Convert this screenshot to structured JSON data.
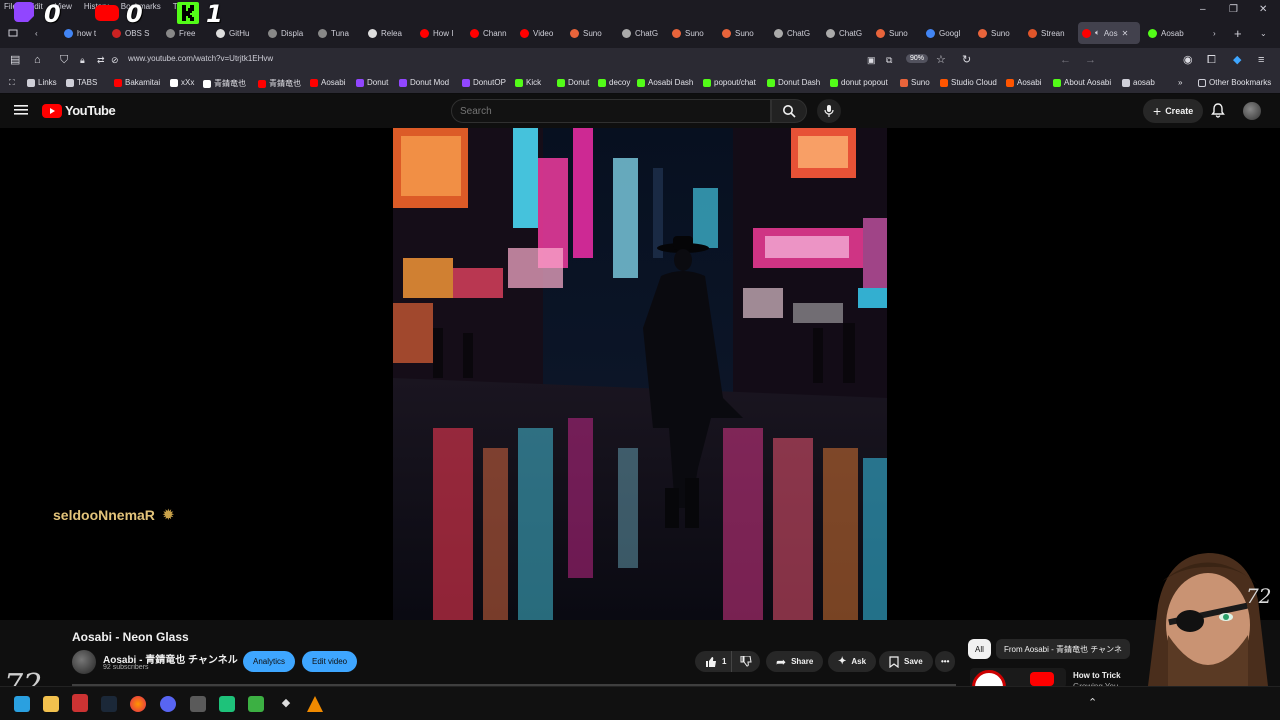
{
  "browser": {
    "menu": [
      "File",
      "Edit",
      "View",
      "History",
      "Bookmarks",
      "Tools"
    ],
    "overlay_counts": [
      "0",
      "0",
      "1"
    ],
    "tabs": [
      {
        "label": "how t",
        "color": "#4285f4"
      },
      {
        "label": "OBS S",
        "color": "#cc2222"
      },
      {
        "label": "Free",
        "color": "#888888"
      },
      {
        "label": "GitHu",
        "color": "#dddddd"
      },
      {
        "label": "Displa",
        "color": "#888888"
      },
      {
        "label": "Tuna",
        "color": "#888888"
      },
      {
        "label": "Relea",
        "color": "#dddddd"
      },
      {
        "label": "How I",
        "color": "#ff0000"
      },
      {
        "label": "Chann",
        "color": "#ff0000"
      },
      {
        "label": "Video",
        "color": "#ff0000"
      },
      {
        "label": "Suno",
        "color": "#e8643b"
      },
      {
        "label": "ChatG",
        "color": "#aaaaaa"
      },
      {
        "label": "Suno",
        "color": "#e8643b"
      },
      {
        "label": "Suno",
        "color": "#e8643b"
      },
      {
        "label": "ChatG",
        "color": "#aaaaaa"
      },
      {
        "label": "ChatG",
        "color": "#aaaaaa"
      },
      {
        "label": "Suno",
        "color": "#e8643b"
      },
      {
        "label": "Googl",
        "color": "#4285f4"
      },
      {
        "label": "Suno",
        "color": "#e8643b"
      },
      {
        "label": "Strean",
        "color": "#e0552a"
      },
      {
        "label": "Aos",
        "color": "#ff0000"
      },
      {
        "label": "Aosab",
        "color": "#53fc18"
      }
    ],
    "url": "www.youtube.com/watch?v=Utrjtk1EHvw",
    "zoom": "90%",
    "bookmarks": [
      {
        "label": "Links",
        "color": "#cfcfd8"
      },
      {
        "label": "TABS",
        "color": "#cfcfd8"
      },
      {
        "label": "Bakamitai",
        "color": "#ff0000"
      },
      {
        "label": "xXx",
        "color": "#ffffff"
      },
      {
        "label": "青錆竜也",
        "color": "#ffffff"
      },
      {
        "label": "青錆竜也",
        "color": "#ff0000"
      },
      {
        "label": "Aosabi",
        "color": "#ff0000"
      },
      {
        "label": "Donut",
        "color": "#9146ff"
      },
      {
        "label": "Donut Mod",
        "color": "#9146ff"
      },
      {
        "label": "DonutOP",
        "color": "#9146ff"
      },
      {
        "label": "Kick",
        "color": "#53fc18"
      },
      {
        "label": "Donut",
        "color": "#53fc18"
      },
      {
        "label": "decoy",
        "color": "#53fc18"
      },
      {
        "label": "Aosabi Dash",
        "color": "#53fc18"
      },
      {
        "label": "popout/chat",
        "color": "#53fc18"
      },
      {
        "label": "Donut Dash",
        "color": "#53fc18"
      },
      {
        "label": "donut popout",
        "color": "#53fc18"
      },
      {
        "label": "Suno",
        "color": "#e8643b"
      },
      {
        "label": "Studio Cloud",
        "color": "#ff5500"
      },
      {
        "label": "Aosabi",
        "color": "#ff5500"
      },
      {
        "label": "About Aosabi",
        "color": "#53fc18"
      },
      {
        "label": "aosab",
        "color": "#cfcfd8"
      }
    ],
    "other_bookmarks": "Other Bookmarks"
  },
  "youtube": {
    "logo_text": "YouTube",
    "search_placeholder": "Search",
    "create_label": "Create"
  },
  "video": {
    "overlay_username": "seldooNnemaR",
    "title": "Aosabi - Neon Glass",
    "channel": "Aosabi - 青錆竜也 チャンネル",
    "subscribers": "92 subscribers",
    "analytics_label": "Analytics",
    "edit_label": "Edit video",
    "likes": "1",
    "share_label": "Share",
    "ask_label": "Ask",
    "save_label": "Save"
  },
  "sidebar": {
    "chip_all": "All",
    "chip_from": "From Aosabi - 青錆竜也 チャンネ",
    "rec_title": "How to Trick",
    "rec_sub": "Growing You"
  },
  "overlay_tag": "72",
  "colors": {
    "accent": "#3ea6ff",
    "youtube_red": "#ff0000"
  }
}
